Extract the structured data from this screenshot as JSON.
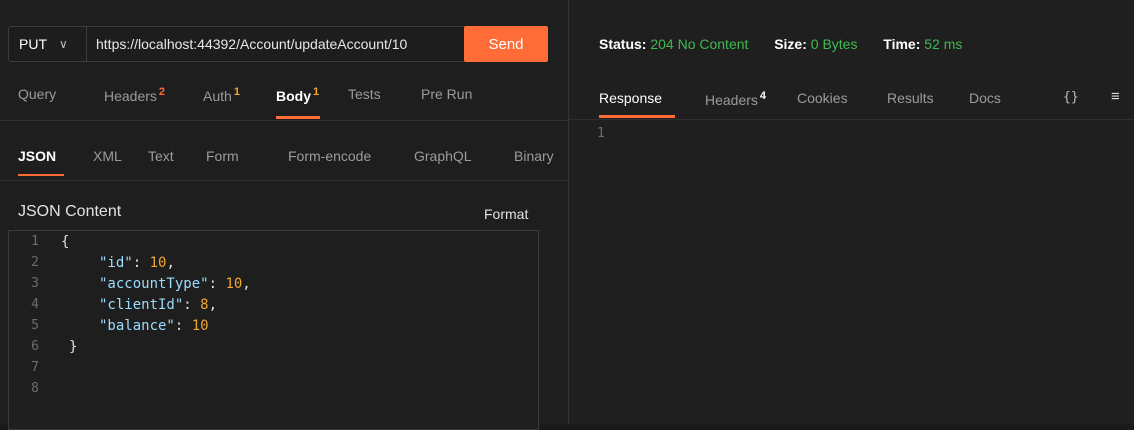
{
  "request": {
    "method": "PUT",
    "url": "https://localhost:44392/Account/updateAccount/10",
    "send_label": "Send",
    "tabs": [
      {
        "label": "Query"
      },
      {
        "label": "Headers",
        "count": "2"
      },
      {
        "label": "Auth",
        "count": "1"
      },
      {
        "label": "Body",
        "count": "1"
      },
      {
        "label": "Tests"
      },
      {
        "label": "Pre Run"
      }
    ],
    "body_types": [
      "JSON",
      "XML",
      "Text",
      "Form",
      "Form-encode",
      "GraphQL",
      "Binary"
    ],
    "json_content_label": "JSON Content",
    "format_label": "Format",
    "editor_lines": [
      {
        "n": "1"
      },
      {
        "n": "2",
        "key": "\"id\"",
        "value": "10",
        "suffix": ","
      },
      {
        "n": "3",
        "key": "\"accountType\"",
        "value": "10",
        "suffix": ","
      },
      {
        "n": "4",
        "key": "\"clientId\"",
        "value": "8",
        "suffix": ","
      },
      {
        "n": "5",
        "key": "\"balance\"",
        "value": "10",
        "suffix": ""
      },
      {
        "n": "6"
      },
      {
        "n": "7"
      },
      {
        "n": "8"
      }
    ],
    "open_brace": "{",
    "close_brace": "}"
  },
  "response": {
    "status_label": "Status:",
    "status_value": "204 No Content",
    "size_label": "Size:",
    "size_value": "0 Bytes",
    "time_label": "Time:",
    "time_value": "52 ms",
    "tabs": [
      {
        "label": "Response"
      },
      {
        "label": "Headers",
        "count": "4"
      },
      {
        "label": "Cookies"
      },
      {
        "label": "Results"
      },
      {
        "label": "Docs"
      }
    ],
    "braces_icon": "{}",
    "menu_icon": "≡",
    "line_number": "1"
  },
  "colors": {
    "accent": "#ff6c37",
    "status_ok": "#3fb950"
  }
}
